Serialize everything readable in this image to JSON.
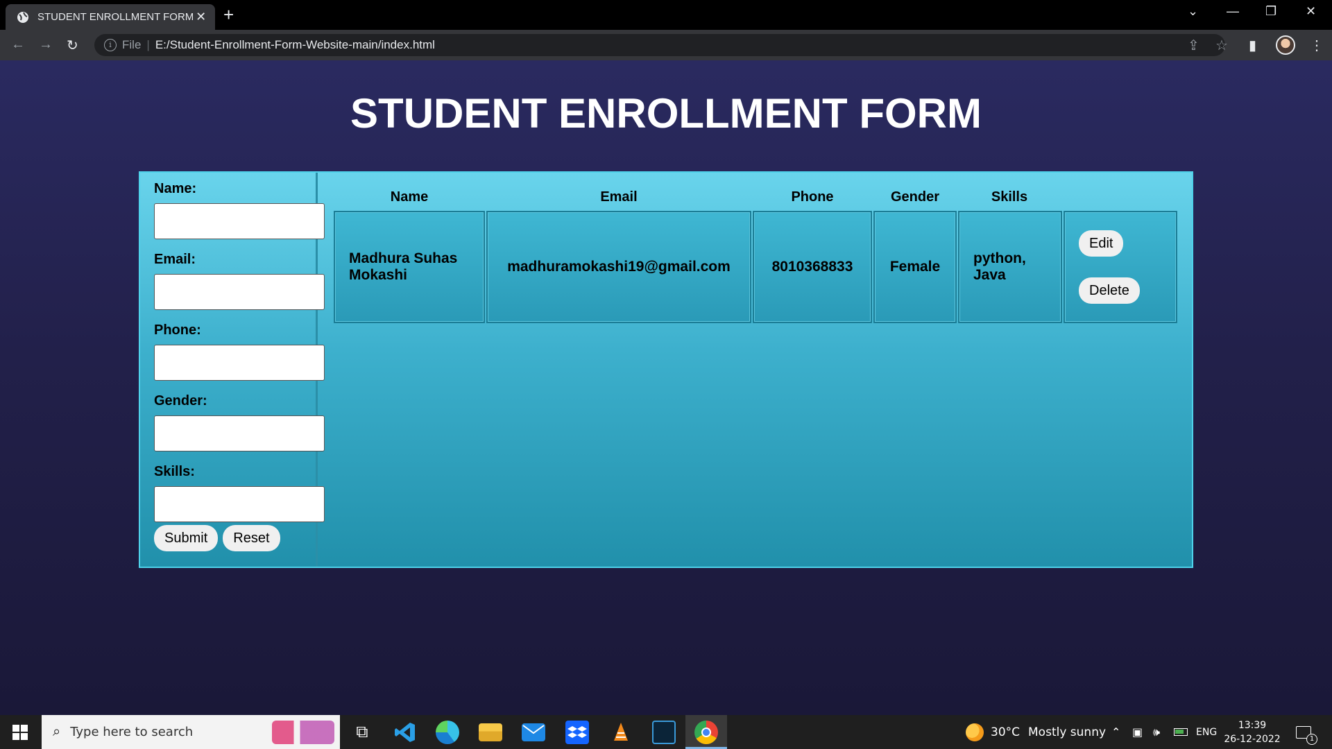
{
  "browser": {
    "tab_title": "STUDENT ENROLLMENT FORM",
    "tab_close": "✕",
    "new_tab": "+",
    "url_scheme": "File",
    "url_separator": "|",
    "url": "E:/Student-Enrollment-Form-Website-main/index.html"
  },
  "page": {
    "title": "STUDENT ENROLLMENT FORM"
  },
  "form": {
    "fields": [
      {
        "label": "Name:",
        "value": ""
      },
      {
        "label": "Email:",
        "value": ""
      },
      {
        "label": "Phone:",
        "value": ""
      },
      {
        "label": "Gender:",
        "value": ""
      },
      {
        "label": "Skills:",
        "value": ""
      }
    ],
    "submit_label": "Submit",
    "reset_label": "Reset"
  },
  "table": {
    "headers": [
      "Name",
      "Email",
      "Phone",
      "Gender",
      "Skills"
    ],
    "rows": [
      {
        "name": "Madhura Suhas Mokashi",
        "email": "madhuramokashi19@gmail.com",
        "phone": "8010368833",
        "gender": "Female",
        "skills": "python, Java",
        "edit_label": "Edit",
        "delete_label": "Delete"
      }
    ]
  },
  "taskbar": {
    "search_placeholder": "Type here to search",
    "weather_temp": "30°C",
    "weather_text": "Mostly sunny",
    "language": "ENG",
    "time": "13:39",
    "date": "26-12-2022",
    "notification_count": "1"
  }
}
